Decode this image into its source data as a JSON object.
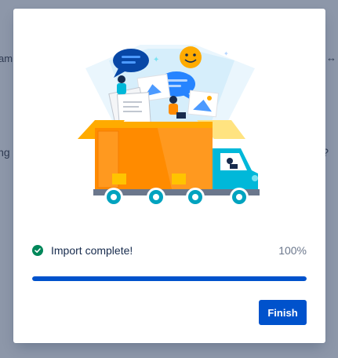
{
  "background": {
    "left_top_fragment": "am",
    "left_mid_fragment": "ing",
    "right_top_fragment": "↔",
    "right_mid_fragment": "?"
  },
  "modal": {
    "status_text": "Import complete!",
    "percent_text": "100%",
    "progress_fraction": 1.0,
    "finish_label": "Finish",
    "icons": {
      "status": "check-circle-icon"
    }
  },
  "colors": {
    "primary": "#0052cc",
    "success": "#00875a",
    "overlay": "#8d97a9"
  }
}
